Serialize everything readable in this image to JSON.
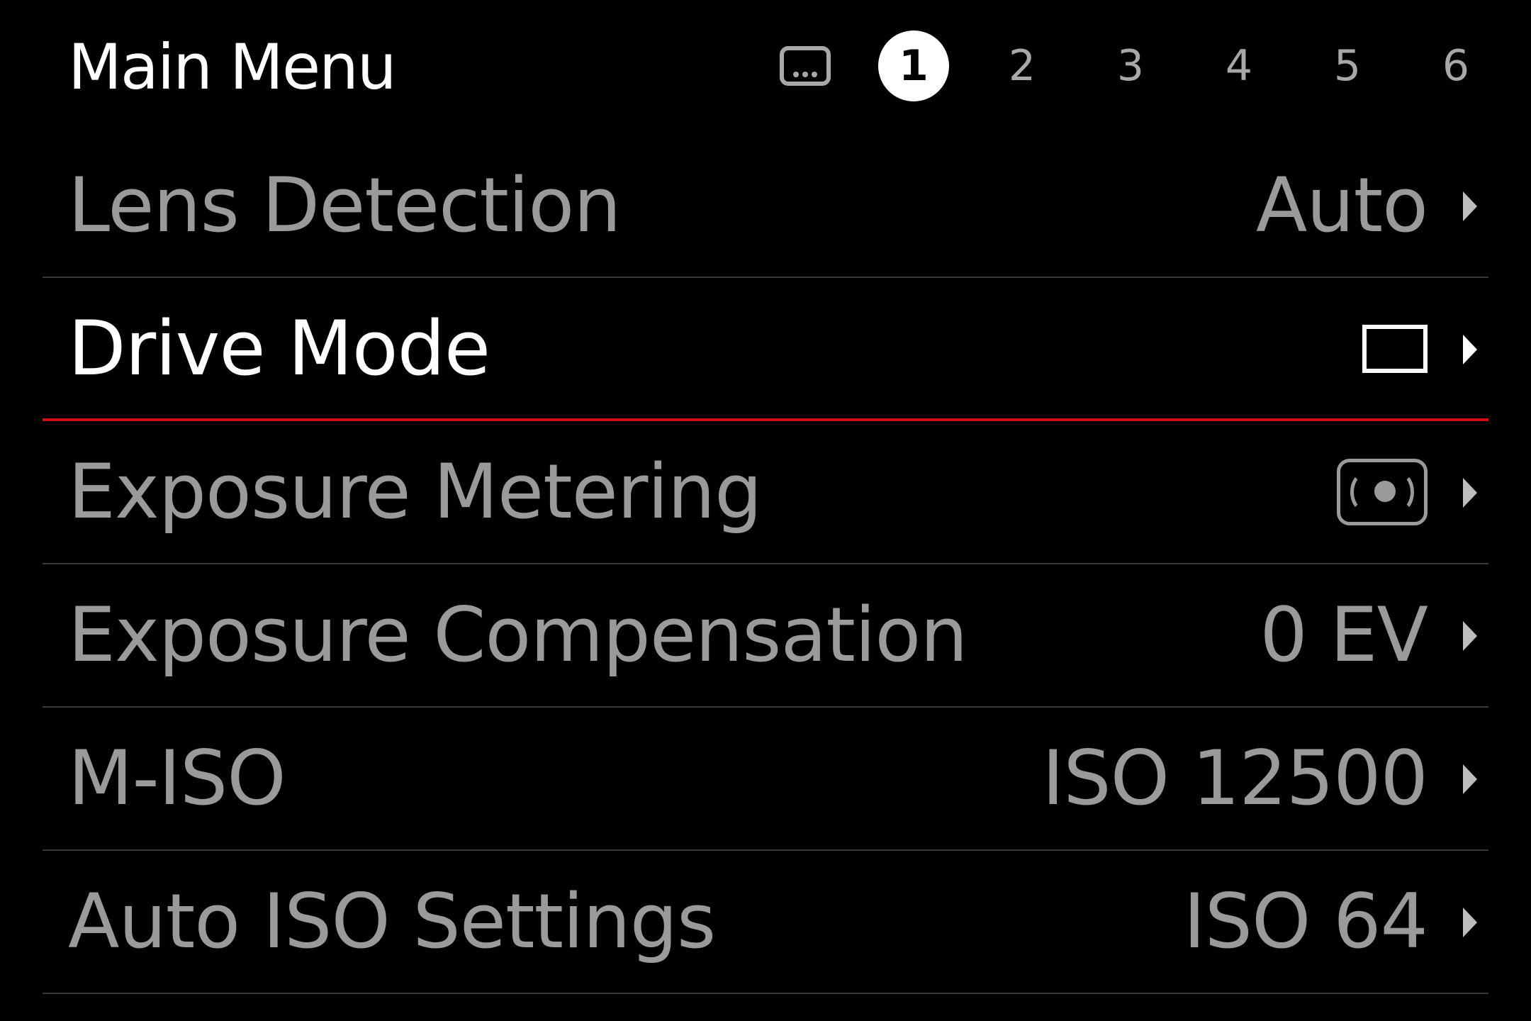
{
  "header": {
    "title": "Main Menu",
    "tabs": [
      {
        "label": "",
        "icon": "favorites-menu-icon"
      },
      {
        "label": "1",
        "active": true
      },
      {
        "label": "2"
      },
      {
        "label": "3"
      },
      {
        "label": "4"
      },
      {
        "label": "5"
      },
      {
        "label": "6"
      }
    ]
  },
  "menu": {
    "items": [
      {
        "label": "Lens Detection",
        "value": "Auto"
      },
      {
        "label": "Drive Mode",
        "value_icon": "single-frame-icon",
        "selected": true
      },
      {
        "label": "Exposure Metering",
        "value_icon": "spot-metering-icon"
      },
      {
        "label": "Exposure Compensation",
        "value": "0 EV"
      },
      {
        "label": "M-ISO",
        "value": "ISO 12500"
      },
      {
        "label": "Auto ISO Settings",
        "value": "ISO 64"
      }
    ]
  },
  "colors": {
    "background": "#000000",
    "selected_text": "#ffffff",
    "normal_text": "#9a9a9a",
    "selection_line": "#d10d0d",
    "divider": "#3a3a3a"
  }
}
